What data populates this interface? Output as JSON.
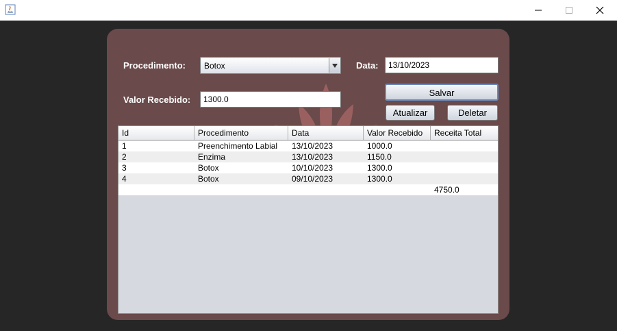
{
  "window": {
    "minimize": "—",
    "maximize": "☐",
    "close": "✕"
  },
  "form": {
    "procedimento_label": "Procedimento:",
    "procedimento_value": "Botox",
    "data_label": "Data:",
    "data_value": "13/10/2023",
    "valor_label": "Valor Recebido:",
    "valor_value": "1300.0"
  },
  "buttons": {
    "salvar": "Salvar",
    "atualizar": "Atualizar",
    "deletar": "Deletar"
  },
  "table": {
    "headers": [
      "Id",
      "Procedimento",
      "Data",
      "Valor Recebido",
      "Receita Total"
    ],
    "rows": [
      [
        "1",
        "Preenchimento Labial",
        "13/10/2023",
        "1000.0",
        ""
      ],
      [
        "2",
        "Enzima",
        "13/10/2023",
        "1150.0",
        ""
      ],
      [
        "3",
        "Botox",
        "10/10/2023",
        "1300.0",
        ""
      ],
      [
        "4",
        "Botox",
        "09/10/2023",
        "1300.0",
        ""
      ],
      [
        "",
        "",
        "",
        "",
        "4750.0"
      ]
    ]
  },
  "colors": {
    "panel": "#6a4a4a",
    "background": "#262626",
    "row_alt": "#eeeeee",
    "table_empty": "#d6d9e0"
  }
}
